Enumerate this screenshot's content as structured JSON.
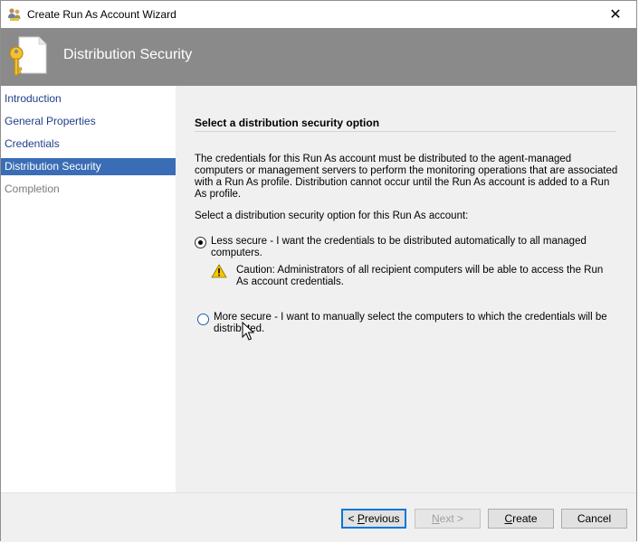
{
  "window": {
    "title": "Create Run As Account Wizard",
    "close_glyph": "✕"
  },
  "banner": {
    "title": "Distribution Security",
    "icon": "key-document-icon"
  },
  "nav": {
    "items": [
      {
        "label": "Introduction",
        "state": "link"
      },
      {
        "label": "General Properties",
        "state": "link"
      },
      {
        "label": "Credentials",
        "state": "link"
      },
      {
        "label": "Distribution Security",
        "state": "active"
      },
      {
        "label": "Completion",
        "state": "disabled"
      }
    ]
  },
  "main": {
    "section_title": "Select a distribution security option",
    "description": "The credentials for this Run As account must be distributed to the agent-managed computers or management servers to perform the monitoring operations that are associated with a Run As profile. Distribution cannot occur until the Run As account is added to a Run As profile.",
    "prompt": "Select a distribution security option for this Run As account:",
    "options": [
      {
        "label": "Less secure - I want the credentials to be distributed automatically to all managed computers.",
        "selected": true
      },
      {
        "label": "More secure - I want to manually select the computers to which the credentials will be distributed.",
        "selected": false
      }
    ],
    "caution": "Caution: Administrators of all recipient computers will be able to access the Run As account credentials."
  },
  "buttons": {
    "previous_prefix": "< ",
    "previous_mnemonic": "P",
    "previous_rest": "revious",
    "next_mnemonic": "N",
    "next_rest": "ext >",
    "create_mnemonic": "C",
    "create_rest": "reate",
    "cancel": "Cancel"
  },
  "colors": {
    "banner_bg": "#8a8a8a",
    "nav_active_bg": "#3a6db5",
    "nav_link": "#1f3f8a",
    "content_bg": "#f0f0f0"
  }
}
